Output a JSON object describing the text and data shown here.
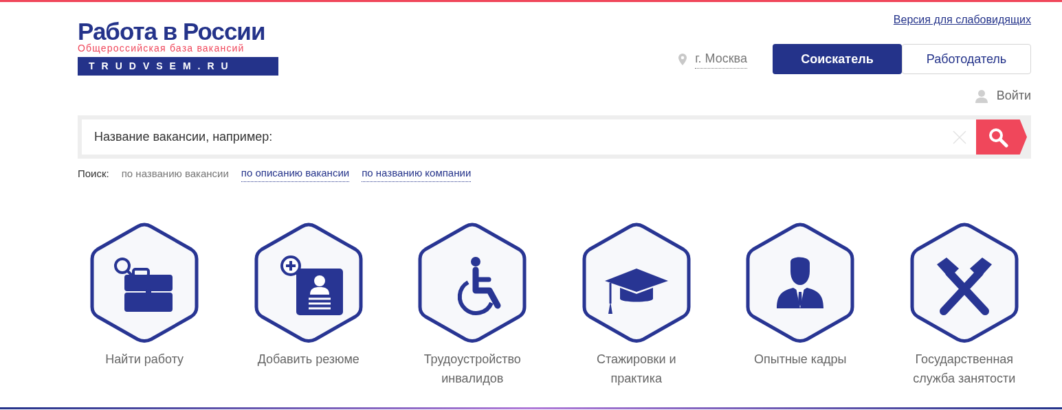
{
  "logo": {
    "title": "Работа в России",
    "subtitle": "Общероссийская база вакансий",
    "domain": "TRUDVSEM.RU"
  },
  "accessibility_link": "Версия для слабовидящих",
  "city": "г. Москва",
  "roles": [
    {
      "label": "Соискатель",
      "selected": true
    },
    {
      "label": "Работодатель",
      "selected": false
    }
  ],
  "login": "Войти",
  "search": {
    "placeholder": "Название вакансии, например:",
    "modes_label": "Поиск:",
    "modes": [
      {
        "label": "по названию вакансии",
        "selected": true
      },
      {
        "label": "по описанию вакансии",
        "selected": false
      },
      {
        "label": "по названию компании",
        "selected": false
      }
    ]
  },
  "tiles": [
    {
      "kind": "briefcase",
      "label": "Найти работу"
    },
    {
      "kind": "resume",
      "label": "Добавить резюме"
    },
    {
      "kind": "wheelchair",
      "label": "Трудоустройство инвалидов"
    },
    {
      "kind": "cap",
      "label": "Стажировки и практика"
    },
    {
      "kind": "person",
      "label": "Опытные кадры"
    },
    {
      "kind": "hammers",
      "label": "Государственная служба занятости"
    }
  ]
}
